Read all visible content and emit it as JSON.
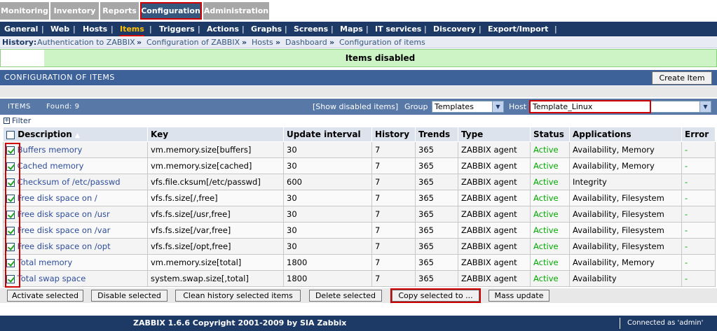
{
  "top_tabs": [
    {
      "label": "Monitoring",
      "active": false
    },
    {
      "label": "Inventory",
      "active": false
    },
    {
      "label": "Reports",
      "active": false
    },
    {
      "label": "Configuration",
      "active": true
    },
    {
      "label": "Administration",
      "active": false
    }
  ],
  "sub_menu": [
    {
      "label": "General",
      "active": false
    },
    {
      "label": "Web",
      "active": false
    },
    {
      "label": "Hosts",
      "active": false
    },
    {
      "label": "Items",
      "active": true
    },
    {
      "label": "Triggers",
      "active": false
    },
    {
      "label": "Actions",
      "active": false
    },
    {
      "label": "Graphs",
      "active": false
    },
    {
      "label": "Screens",
      "active": false
    },
    {
      "label": "Maps",
      "active": false
    },
    {
      "label": "IT services",
      "active": false
    },
    {
      "label": "Discovery",
      "active": false
    },
    {
      "label": "Export/Import",
      "active": false
    }
  ],
  "history": {
    "label": "History:",
    "crumbs": [
      "Authentication to ZABBIX",
      "Configuration of ZABBIX",
      "Hosts",
      "Dashboard",
      "Configuration of items"
    ],
    "separator": "»"
  },
  "message": "Items disabled",
  "config": {
    "title": "CONFIGURATION OF ITEMS",
    "create_button": "Create Item"
  },
  "items_bar": {
    "items_label": "ITEMS",
    "found_label": "Found: 9",
    "show_disabled": "[Show disabled items]",
    "group_label": "Group",
    "group_value": "Templates",
    "host_label": "Host",
    "host_value": "Template_Linux"
  },
  "filter_label": "Filter",
  "table": {
    "headers": [
      "Description",
      "Key",
      "Update interval",
      "History",
      "Trends",
      "Type",
      "Status",
      "Applications",
      "Error"
    ],
    "rows": [
      {
        "desc": "Buffers memory",
        "key": "vm.memory.size[buffers]",
        "interval": "30",
        "history": "7",
        "trends": "365",
        "type": "ZABBIX agent",
        "status": "Active",
        "apps": "Availability, Memory",
        "error": "-"
      },
      {
        "desc": "Cached memory",
        "key": "vm.memory.size[cached]",
        "interval": "30",
        "history": "7",
        "trends": "365",
        "type": "ZABBIX agent",
        "status": "Active",
        "apps": "Availability, Memory",
        "error": "-"
      },
      {
        "desc": "Checksum of /etc/passwd",
        "key": "vfs.file.cksum[/etc/passwd]",
        "interval": "600",
        "history": "7",
        "trends": "365",
        "type": "ZABBIX agent",
        "status": "Active",
        "apps": "Integrity",
        "error": "-"
      },
      {
        "desc": "Free disk space on /",
        "key": "vfs.fs.size[/,free]",
        "interval": "30",
        "history": "7",
        "trends": "365",
        "type": "ZABBIX agent",
        "status": "Active",
        "apps": "Availability, Filesystem",
        "error": "-"
      },
      {
        "desc": "Free disk space on /usr",
        "key": "vfs.fs.size[/usr,free]",
        "interval": "30",
        "history": "7",
        "trends": "365",
        "type": "ZABBIX agent",
        "status": "Active",
        "apps": "Availability, Filesystem",
        "error": "-"
      },
      {
        "desc": "Free disk space on /var",
        "key": "vfs.fs.size[/var,free]",
        "interval": "30",
        "history": "7",
        "trends": "365",
        "type": "ZABBIX agent",
        "status": "Active",
        "apps": "Availability, Filesystem",
        "error": "-"
      },
      {
        "desc": "Free disk space on /opt",
        "key": "vfs.fs.size[/opt,free]",
        "interval": "30",
        "history": "7",
        "trends": "365",
        "type": "ZABBIX agent",
        "status": "Active",
        "apps": "Availability, Filesystem",
        "error": "-"
      },
      {
        "desc": "Total memory",
        "key": "vm.memory.size[total]",
        "interval": "1800",
        "history": "7",
        "trends": "365",
        "type": "ZABBIX agent",
        "status": "Active",
        "apps": "Availability, Memory",
        "error": "-"
      },
      {
        "desc": "Total swap space",
        "key": "system.swap.size[,total]",
        "interval": "1800",
        "history": "7",
        "trends": "365",
        "type": "ZABBIX agent",
        "status": "Active",
        "apps": "Availability",
        "error": "-"
      }
    ]
  },
  "actions": [
    "Activate selected",
    "Disable selected",
    "Clean history selected items",
    "Delete selected",
    "Copy selected to ...",
    "Mass update"
  ],
  "footer": {
    "text": "ZABBIX 1.6.6 Copyright 2001-2009 by  SIA Zabbix",
    "right": "Connected as 'admin'"
  },
  "colors": {
    "header_blue": "#3d629a",
    "nav_dark": "#1d3a66",
    "active_green": "#00aa00",
    "highlight_red": "#d10000",
    "message_green": "#cdf4c5"
  }
}
